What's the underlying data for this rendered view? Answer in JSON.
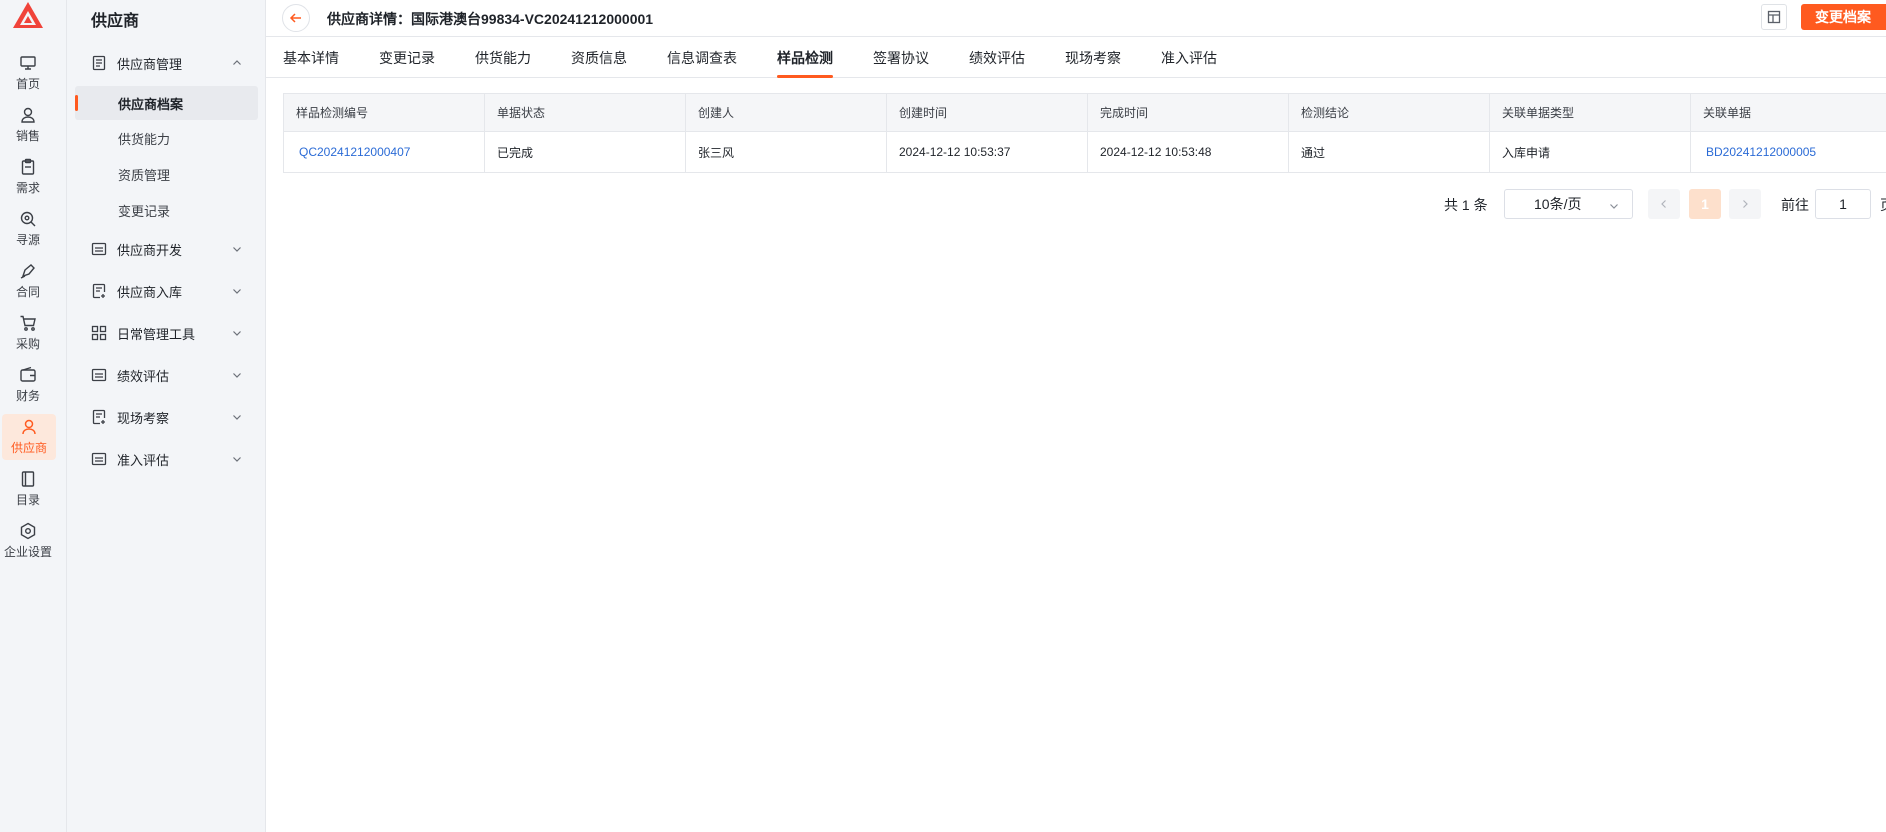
{
  "rail": {
    "items": [
      {
        "label": "首页",
        "icon": "monitor-icon"
      },
      {
        "label": "销售",
        "icon": "person-icon"
      },
      {
        "label": "需求",
        "icon": "clipboard-icon"
      },
      {
        "label": "寻源",
        "icon": "search-doc-icon"
      },
      {
        "label": "合同",
        "icon": "pen-icon"
      },
      {
        "label": "采购",
        "icon": "cart-icon"
      },
      {
        "label": "财务",
        "icon": "wallet-icon"
      },
      {
        "label": "供应商",
        "icon": "supplier-icon"
      },
      {
        "label": "目录",
        "icon": "book-icon"
      },
      {
        "label": "企业设置",
        "icon": "hexagon-gear-icon"
      }
    ]
  },
  "sidebar": {
    "title": "供应商",
    "groups": [
      {
        "label": "供应商管理",
        "expanded": true
      },
      {
        "label": "供应商开发"
      },
      {
        "label": "供应商入库"
      },
      {
        "label": "日常管理工具"
      },
      {
        "label": "绩效评估"
      },
      {
        "label": "现场考察"
      },
      {
        "label": "准入评估"
      }
    ],
    "subitems": [
      {
        "label": "供应商档案"
      },
      {
        "label": "供货能力"
      },
      {
        "label": "资质管理"
      },
      {
        "label": "变更记录"
      }
    ]
  },
  "header": {
    "title": "供应商详情：国际港澳台99834-VC20241212000001",
    "change_button": "变更档案"
  },
  "tabs": [
    {
      "label": "基本详情"
    },
    {
      "label": "变更记录"
    },
    {
      "label": "供货能力"
    },
    {
      "label": "资质信息"
    },
    {
      "label": "信息调查表"
    },
    {
      "label": "样品检测"
    },
    {
      "label": "签署协议"
    },
    {
      "label": "绩效评估"
    },
    {
      "label": "现场考察"
    },
    {
      "label": "准入评估"
    }
  ],
  "active_tab": "样品检测",
  "table": {
    "columns": [
      "样品检测编号",
      "单据状态",
      "创建人",
      "创建时间",
      "完成时间",
      "检测结论",
      "关联单据类型",
      "关联单据"
    ],
    "rows": [
      [
        "QC20241212000407",
        "已完成",
        "张三风",
        "2024-12-12 10:53:37",
        "2024-12-12 10:53:48",
        "通过",
        "入库申请",
        "BD20241212000005"
      ]
    ]
  },
  "pagination": {
    "total": "共 1 条",
    "page_size": "10条/页",
    "current_page": "1",
    "goto_label": "前往",
    "goto_value": "1",
    "unit": "页"
  },
  "colors": {
    "accent": "#ff5a1f",
    "link": "#2b6bd6"
  }
}
